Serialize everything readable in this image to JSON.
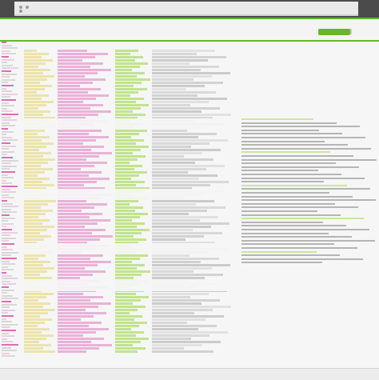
{
  "window": {
    "title": "",
    "controls": [
      "close",
      "minimize",
      "maximize"
    ]
  },
  "toolbar": {
    "left_label": "",
    "icons": [
      "back-icon",
      "forward-icon",
      "menu-icon"
    ]
  },
  "colors": {
    "accent": "#6ab52c",
    "chrome": "#4b4b4b",
    "pink": "#e6a6d2",
    "yellow": "#eadf9c",
    "green": "#b6e07a",
    "magenta": "#d94aa3",
    "gray": "#b9b9b9"
  },
  "status": {
    "left": "",
    "right": ""
  }
}
